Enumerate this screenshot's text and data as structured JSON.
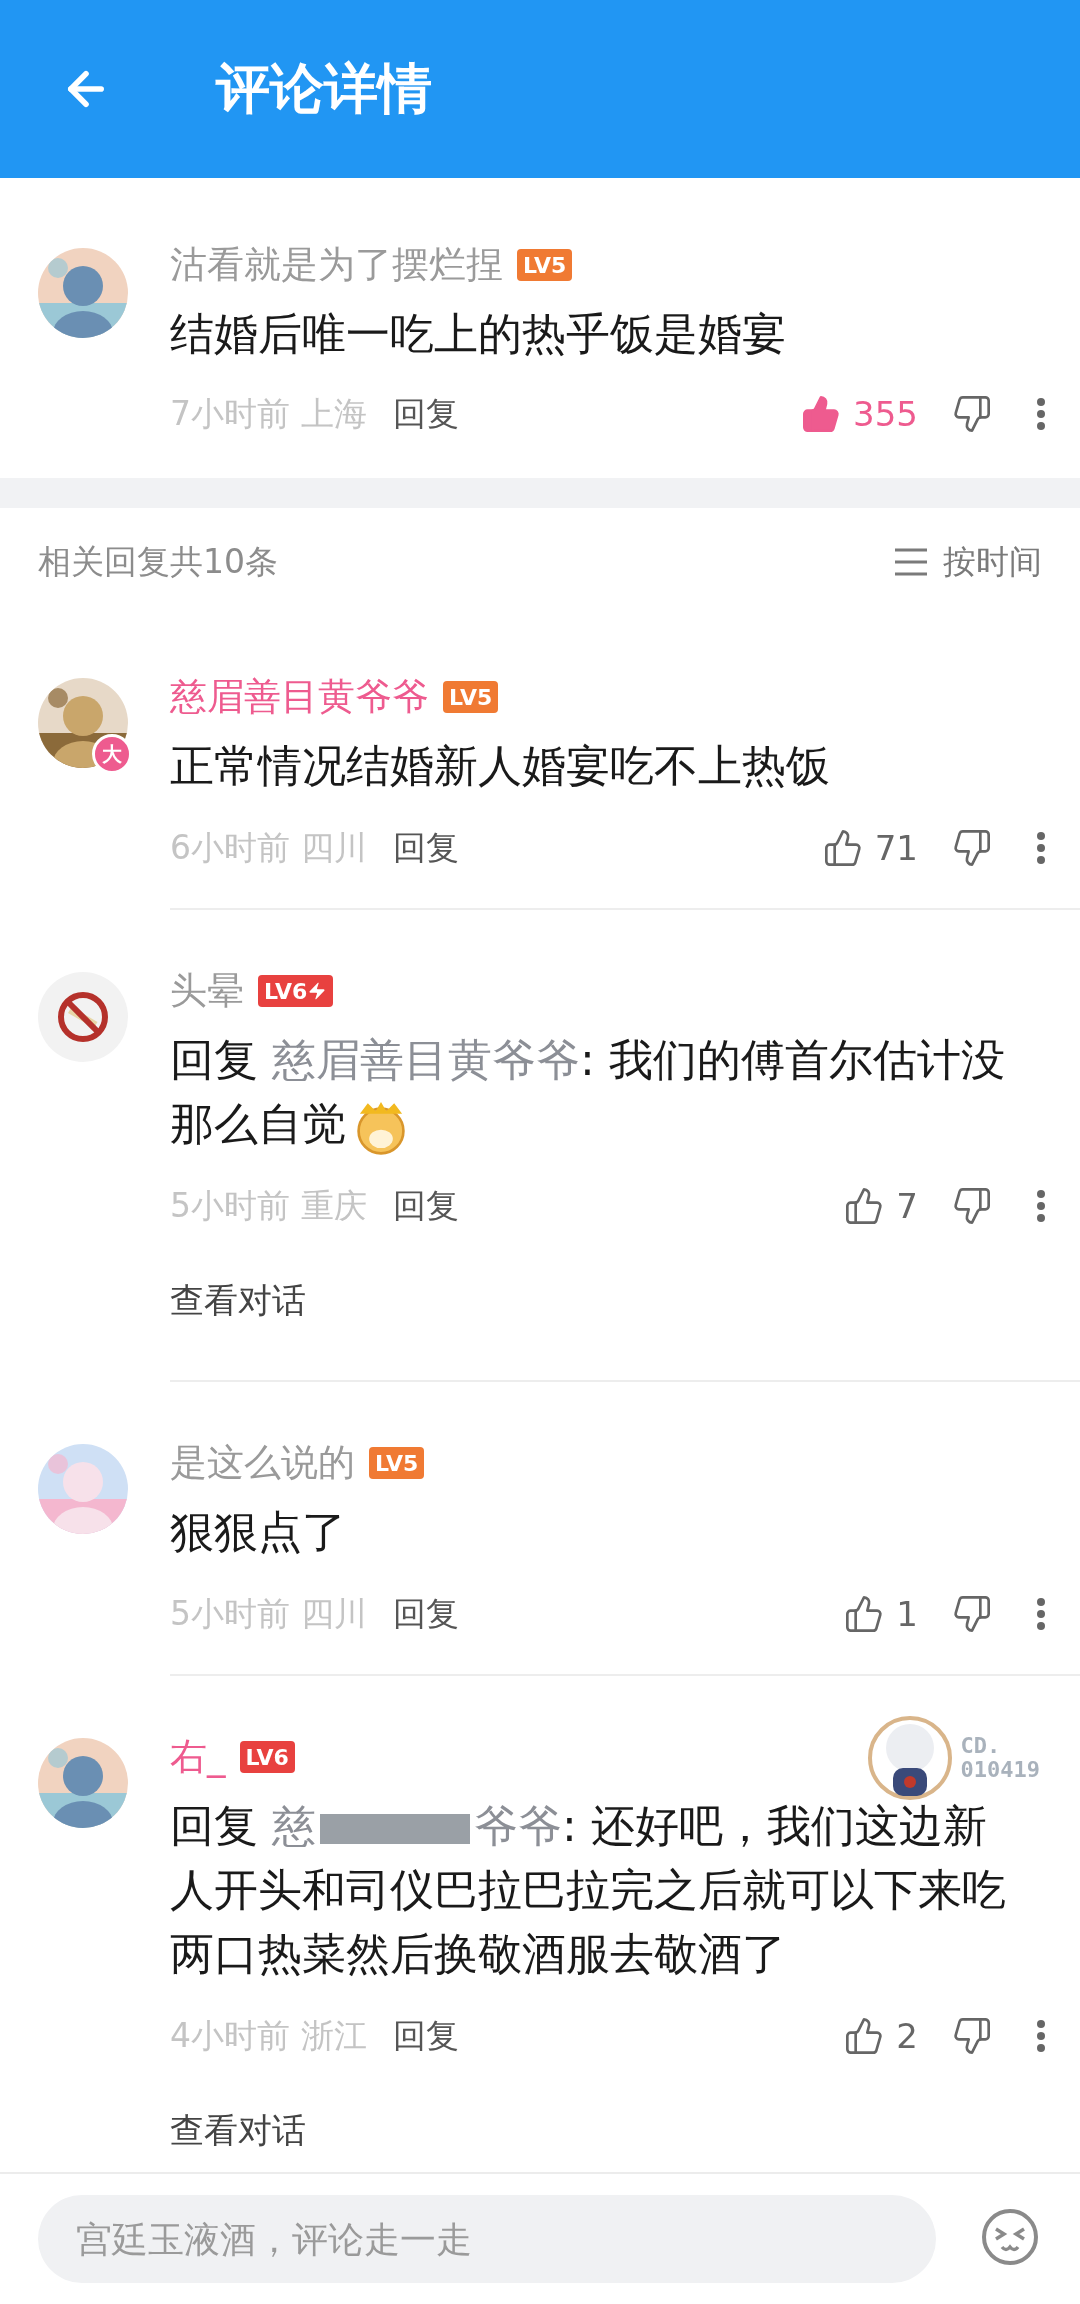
{
  "header": {
    "title": "评论详情"
  },
  "main_comment": {
    "username": "沽看就是为了摆烂捏",
    "level": "LV5",
    "color": "#f07a33",
    "text": "结婚后唯一吃上的热乎饭是婚宴",
    "time": "7小时前",
    "location": "上海",
    "reply_label": "回复",
    "likes": "355",
    "liked": true
  },
  "replies_header": {
    "count_label": "相关回复共10条",
    "sort_label": "按时间"
  },
  "replies": [
    {
      "avatar_badge": "大",
      "username": "慈眉善目黄爷爷",
      "vip": true,
      "level": "LV5",
      "color": "#f07a33",
      "text": "正常情况结婚新人婚宴吃不上热饭",
      "time": "6小时前",
      "location": "四川",
      "reply_label": "回复",
      "likes": "71",
      "liked": false
    },
    {
      "avatar": {
        "kind": "no-smoking"
      },
      "username": "头晕",
      "vip": false,
      "level": "LV6",
      "color": "#e8413f",
      "bolt": true,
      "reply_prefix": "回复",
      "reply_to": "慈眉善目黄爷爷",
      "text": ": 我们的傅首尔估计没那么自觉",
      "emoji": true,
      "time": "5小时前",
      "location": "重庆",
      "reply_label": "回复",
      "likes": "7",
      "liked": false,
      "view_conversation": "查看对话"
    },
    {
      "username": "是这么说的",
      "vip": false,
      "level": "LV5",
      "color": "#f07a33",
      "text": "狠狠点了",
      "time": "5小时前",
      "location": "四川",
      "reply_label": "回复",
      "likes": "1",
      "liked": false
    },
    {
      "username": "右_",
      "vip": true,
      "level": "LV6",
      "color": "#e8413f",
      "pendant": {
        "lines": [
          "CD.",
          "010419"
        ]
      },
      "reply_prefix": "回复",
      "reply_to": "慈",
      "redacted": true,
      "reply_to_tail": "爷爷",
      "text": ": 还好吧，我们这边新人开头和司仪巴拉巴拉完之后就可以下来吃两口热菜然后换敬酒服去敬酒了",
      "time": "4小时前",
      "location": "浙江",
      "reply_label": "回复",
      "likes": "2",
      "liked": false,
      "view_conversation": "查看对话"
    }
  ],
  "comment_bar": {
    "placeholder": "宫廷玉液酒，评论走一走"
  }
}
